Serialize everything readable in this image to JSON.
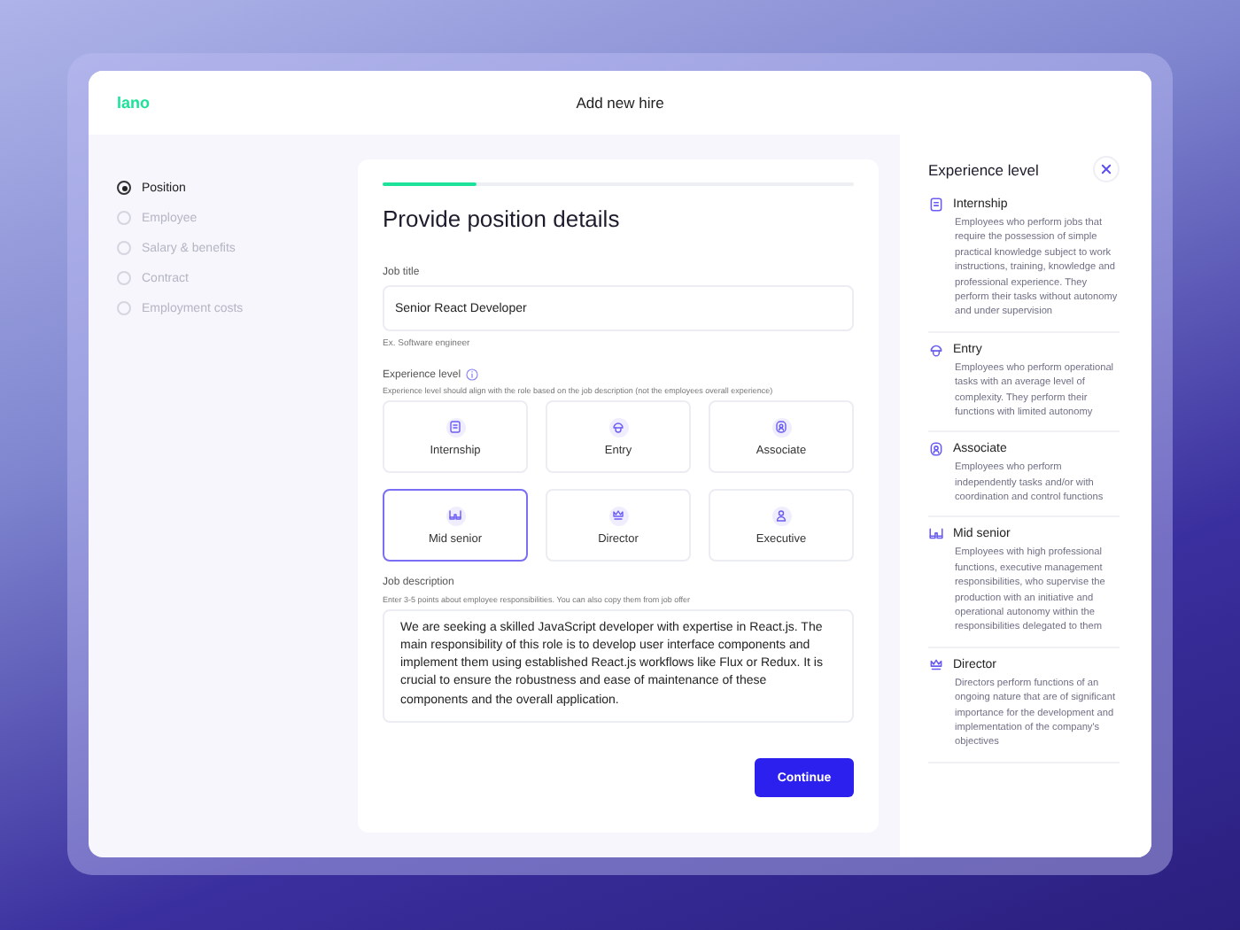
{
  "header": {
    "logo": "lano",
    "title": "Add new hire"
  },
  "steps": [
    {
      "label": "Position",
      "selected": true
    },
    {
      "label": "Employee",
      "selected": false
    },
    {
      "label": "Salary & benefits",
      "selected": false
    },
    {
      "label": "Contract",
      "selected": false
    },
    {
      "label": "Employment costs",
      "selected": false
    }
  ],
  "form": {
    "progress": {
      "level": 0.2
    },
    "title": "Provide position details",
    "job_title": {
      "label": "Job title",
      "value": "Senior React Developer",
      "hint": "Ex. Software engineer"
    },
    "experience": {
      "label": "Experience level",
      "hint": "Experience level should align with the role based on the job description (not the employees overall experience)",
      "options": [
        {
          "kind": "internship",
          "label": "Internship",
          "selected": false
        },
        {
          "kind": "entry",
          "label": "Entry",
          "selected": false
        },
        {
          "kind": "associate",
          "label": "Associate",
          "selected": false
        },
        {
          "kind": "midsenior",
          "label": "Mid senior",
          "selected": true
        },
        {
          "kind": "director",
          "label": "Director",
          "selected": false
        },
        {
          "kind": "executive",
          "label": "Executive",
          "selected": false
        }
      ]
    },
    "description": {
      "label": "Job description",
      "hint": "Enter 3-5 points about employee responsibilities. You can also copy them from job offer",
      "value": "We are seeking a skilled JavaScript developer with expertise in React.js. The main responsibility of this role is to develop user interface components and implement them using established React.js workflows like Flux or Redux. It is crucial to ensure the robustness and ease of maintenance of these components and the overall application."
    },
    "continue_button": "Continue"
  },
  "panel": {
    "title": "Experience level",
    "items": [
      {
        "kind": "internship",
        "title": "Internship",
        "text": "Employees who perform jobs that require the possession of simple practical knowledge subject to work instructions, training, knowledge and professional experience. They perform their tasks without autonomy and under supervision"
      },
      {
        "kind": "entry",
        "title": "Entry",
        "text": "Employees who perform operational tasks with an average level of complexity. They perform their functions with limited autonomy"
      },
      {
        "kind": "associate",
        "title": "Associate",
        "text": "Employees who perform independently tasks and/or with coordination and control functions"
      },
      {
        "kind": "midsenior",
        "title": "Mid senior",
        "text": "Employees with high professional functions, executive management responsibilities, who supervise the production with an initiative and operational autonomy within the responsibilities delegated to them"
      },
      {
        "kind": "director",
        "title": "Director",
        "text": "Directors perform functions of an ongoing nature that are of significant importance for the development and implementation of the company's objectives"
      }
    ]
  }
}
